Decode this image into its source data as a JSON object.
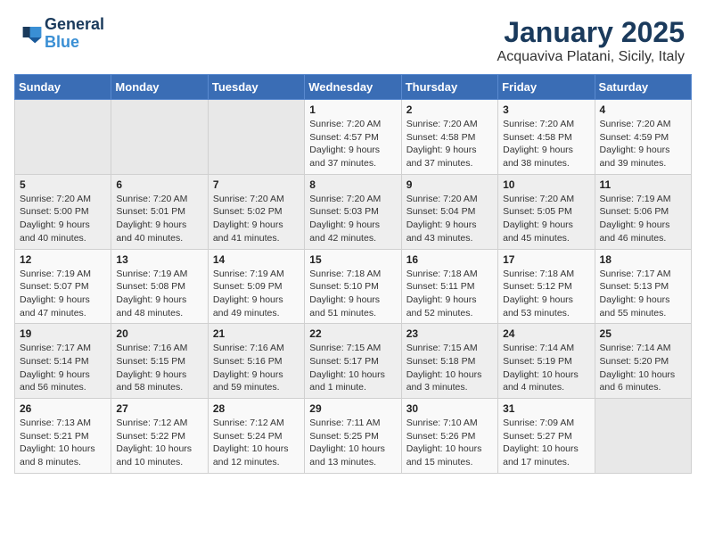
{
  "header": {
    "logo_line1": "General",
    "logo_line2": "Blue",
    "main_title": "January 2025",
    "subtitle": "Acquaviva Platani, Sicily, Italy"
  },
  "calendar": {
    "days_of_week": [
      "Sunday",
      "Monday",
      "Tuesday",
      "Wednesday",
      "Thursday",
      "Friday",
      "Saturday"
    ],
    "weeks": [
      [
        {
          "num": "",
          "detail": ""
        },
        {
          "num": "",
          "detail": ""
        },
        {
          "num": "",
          "detail": ""
        },
        {
          "num": "1",
          "detail": "Sunrise: 7:20 AM\nSunset: 4:57 PM\nDaylight: 9 hours and 37 minutes."
        },
        {
          "num": "2",
          "detail": "Sunrise: 7:20 AM\nSunset: 4:58 PM\nDaylight: 9 hours and 37 minutes."
        },
        {
          "num": "3",
          "detail": "Sunrise: 7:20 AM\nSunset: 4:58 PM\nDaylight: 9 hours and 38 minutes."
        },
        {
          "num": "4",
          "detail": "Sunrise: 7:20 AM\nSunset: 4:59 PM\nDaylight: 9 hours and 39 minutes."
        }
      ],
      [
        {
          "num": "5",
          "detail": "Sunrise: 7:20 AM\nSunset: 5:00 PM\nDaylight: 9 hours and 40 minutes."
        },
        {
          "num": "6",
          "detail": "Sunrise: 7:20 AM\nSunset: 5:01 PM\nDaylight: 9 hours and 40 minutes."
        },
        {
          "num": "7",
          "detail": "Sunrise: 7:20 AM\nSunset: 5:02 PM\nDaylight: 9 hours and 41 minutes."
        },
        {
          "num": "8",
          "detail": "Sunrise: 7:20 AM\nSunset: 5:03 PM\nDaylight: 9 hours and 42 minutes."
        },
        {
          "num": "9",
          "detail": "Sunrise: 7:20 AM\nSunset: 5:04 PM\nDaylight: 9 hours and 43 minutes."
        },
        {
          "num": "10",
          "detail": "Sunrise: 7:20 AM\nSunset: 5:05 PM\nDaylight: 9 hours and 45 minutes."
        },
        {
          "num": "11",
          "detail": "Sunrise: 7:19 AM\nSunset: 5:06 PM\nDaylight: 9 hours and 46 minutes."
        }
      ],
      [
        {
          "num": "12",
          "detail": "Sunrise: 7:19 AM\nSunset: 5:07 PM\nDaylight: 9 hours and 47 minutes."
        },
        {
          "num": "13",
          "detail": "Sunrise: 7:19 AM\nSunset: 5:08 PM\nDaylight: 9 hours and 48 minutes."
        },
        {
          "num": "14",
          "detail": "Sunrise: 7:19 AM\nSunset: 5:09 PM\nDaylight: 9 hours and 49 minutes."
        },
        {
          "num": "15",
          "detail": "Sunrise: 7:18 AM\nSunset: 5:10 PM\nDaylight: 9 hours and 51 minutes."
        },
        {
          "num": "16",
          "detail": "Sunrise: 7:18 AM\nSunset: 5:11 PM\nDaylight: 9 hours and 52 minutes."
        },
        {
          "num": "17",
          "detail": "Sunrise: 7:18 AM\nSunset: 5:12 PM\nDaylight: 9 hours and 53 minutes."
        },
        {
          "num": "18",
          "detail": "Sunrise: 7:17 AM\nSunset: 5:13 PM\nDaylight: 9 hours and 55 minutes."
        }
      ],
      [
        {
          "num": "19",
          "detail": "Sunrise: 7:17 AM\nSunset: 5:14 PM\nDaylight: 9 hours and 56 minutes."
        },
        {
          "num": "20",
          "detail": "Sunrise: 7:16 AM\nSunset: 5:15 PM\nDaylight: 9 hours and 58 minutes."
        },
        {
          "num": "21",
          "detail": "Sunrise: 7:16 AM\nSunset: 5:16 PM\nDaylight: 9 hours and 59 minutes."
        },
        {
          "num": "22",
          "detail": "Sunrise: 7:15 AM\nSunset: 5:17 PM\nDaylight: 10 hours and 1 minute."
        },
        {
          "num": "23",
          "detail": "Sunrise: 7:15 AM\nSunset: 5:18 PM\nDaylight: 10 hours and 3 minutes."
        },
        {
          "num": "24",
          "detail": "Sunrise: 7:14 AM\nSunset: 5:19 PM\nDaylight: 10 hours and 4 minutes."
        },
        {
          "num": "25",
          "detail": "Sunrise: 7:14 AM\nSunset: 5:20 PM\nDaylight: 10 hours and 6 minutes."
        }
      ],
      [
        {
          "num": "26",
          "detail": "Sunrise: 7:13 AM\nSunset: 5:21 PM\nDaylight: 10 hours and 8 minutes."
        },
        {
          "num": "27",
          "detail": "Sunrise: 7:12 AM\nSunset: 5:22 PM\nDaylight: 10 hours and 10 minutes."
        },
        {
          "num": "28",
          "detail": "Sunrise: 7:12 AM\nSunset: 5:24 PM\nDaylight: 10 hours and 12 minutes."
        },
        {
          "num": "29",
          "detail": "Sunrise: 7:11 AM\nSunset: 5:25 PM\nDaylight: 10 hours and 13 minutes."
        },
        {
          "num": "30",
          "detail": "Sunrise: 7:10 AM\nSunset: 5:26 PM\nDaylight: 10 hours and 15 minutes."
        },
        {
          "num": "31",
          "detail": "Sunrise: 7:09 AM\nSunset: 5:27 PM\nDaylight: 10 hours and 17 minutes."
        },
        {
          "num": "",
          "detail": ""
        }
      ]
    ]
  }
}
